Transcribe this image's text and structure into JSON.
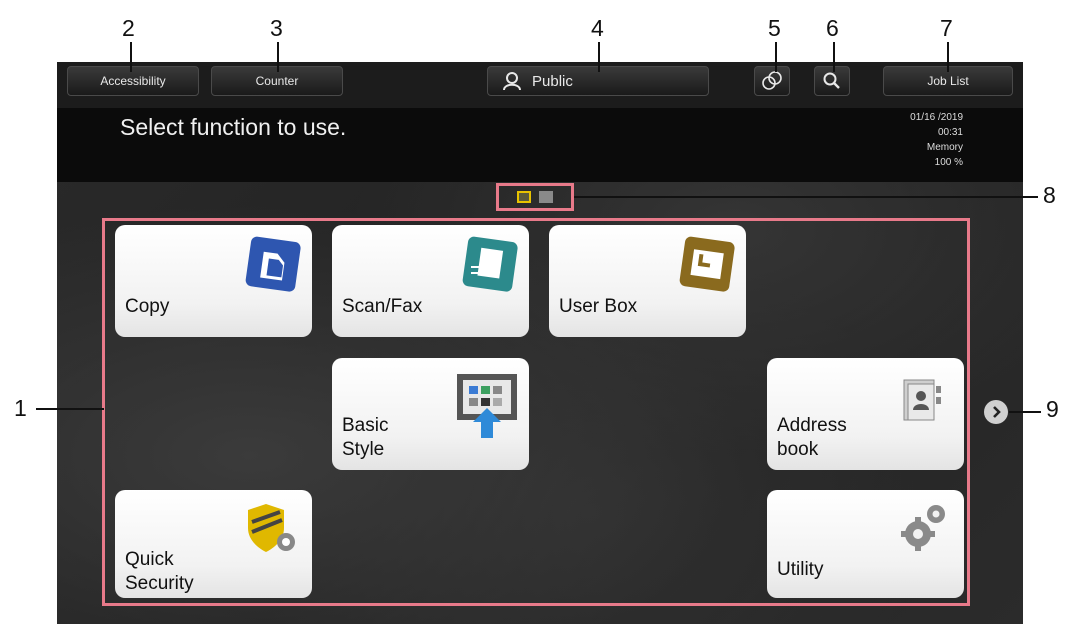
{
  "callouts": {
    "n1": "1",
    "n2": "2",
    "n3": "3",
    "n4": "4",
    "n5": "5",
    "n6": "6",
    "n7": "7",
    "n8": "8",
    "n9": "9"
  },
  "header": {
    "accessibility_label": "Accessibility",
    "counter_label": "Counter",
    "user_label": "Public",
    "job_list_label": "Job List"
  },
  "message": "Select function to use.",
  "status": {
    "date": "01/16 /2019",
    "time": "00:31",
    "memory_label": "Memory",
    "memory_value": "100 %"
  },
  "tiles": {
    "copy": "Copy",
    "scan_fax": "Scan/Fax",
    "user_box": "User Box",
    "basic_style_1": "Basic",
    "basic_style_2": "Style",
    "address_book_1": "Address",
    "address_book_2": "book",
    "quick_security_1": "Quick",
    "quick_security_2": "Security",
    "utility": "Utility"
  },
  "colors": {
    "copy_icon": "#2e56b0",
    "scan_icon": "#2c8a8c",
    "userbox_icon": "#8a6a1e",
    "security_icon": "#e0b800",
    "callout_frame": "#e87a8a"
  },
  "pager": {
    "current_page": 1,
    "total_pages": 2
  }
}
